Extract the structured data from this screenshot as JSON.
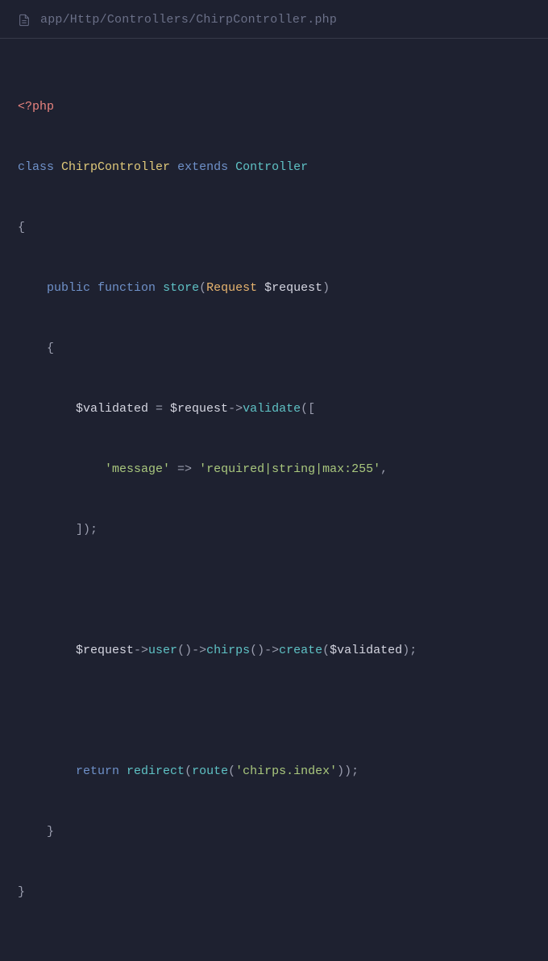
{
  "filepath": "app/Http/Controllers/ChirpController.php",
  "code": {
    "open_tag": "<?php",
    "kw_class": "class",
    "classname": "ChirpController",
    "kw_extends": "extends",
    "parentclass": "Controller",
    "brace_open": "{",
    "kw_public": "public",
    "kw_function": "function",
    "fn_store": "store",
    "paren_open": "(",
    "type_request": "Request",
    "var_request": "$request",
    "paren_close": ")",
    "fn_brace_open": "    {",
    "var_validated": "$validated",
    "op_assign": " = ",
    "arrow1": "->",
    "meth_validate": "validate",
    "arr_open": "([",
    "str_message_key": "'message'",
    "op_arrow": " => ",
    "str_rules": "'required|string|max:255'",
    "comma": ",",
    "arr_close": "        ]);",
    "arrow2": "->",
    "meth_user": "user",
    "empty_parens": "()",
    "arrow3": "->",
    "meth_chirps": "chirps",
    "arrow4": "->",
    "meth_create": "create",
    "create_args_open": "(",
    "create_args_close": ");",
    "kw_return": "return",
    "fn_redirect": "redirect",
    "fn_route": "route",
    "str_route": "'chirps.index'",
    "redirect_close": "));",
    "fn_brace_close": "    }",
    "brace_close": "}"
  }
}
